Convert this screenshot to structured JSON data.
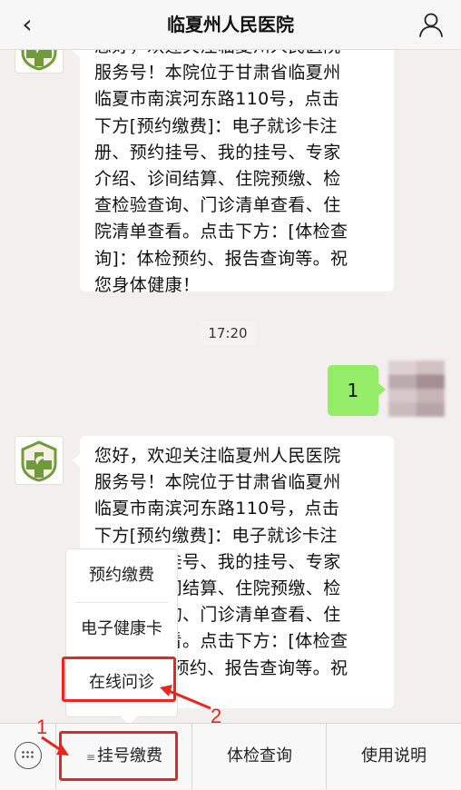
{
  "header": {
    "title": "临夏州人民医院",
    "back_icon": "chevron-left-icon",
    "profile_icon": "person-icon"
  },
  "chat": {
    "welcome_lines": [
      "您好，欢迎关注临夏州人民医院",
      "服务号！本院位于甘肃省临夏州",
      "临夏市南滨河东路110号，点击",
      "下方[预约缴费]：电子就诊卡注",
      "册、预约挂号、我的挂号、专家",
      "介绍、诊间结算、住院预缴、检",
      "查检验查询、门诊清单查看、住",
      "院清单查看。点击下方：[体检查",
      "询]：体检预约、报告查询等。祝",
      "您身体健康！"
    ],
    "time_label": "17:20",
    "user_message": "1"
  },
  "popup_menu": {
    "items": [
      "预约缴费",
      "电子健康卡",
      "在线问诊"
    ]
  },
  "bottom_menu": {
    "items": [
      "挂号缴费",
      "体检查询",
      "使用说明"
    ],
    "menu_lines_icon": "≡"
  },
  "annotations": {
    "step1": "1",
    "step2": "2",
    "color": "#e8261f"
  },
  "colors": {
    "chat_background": "#f4efef",
    "user_bubble": "#95ec69",
    "hospital_logo_green": "#6f9b3a"
  }
}
